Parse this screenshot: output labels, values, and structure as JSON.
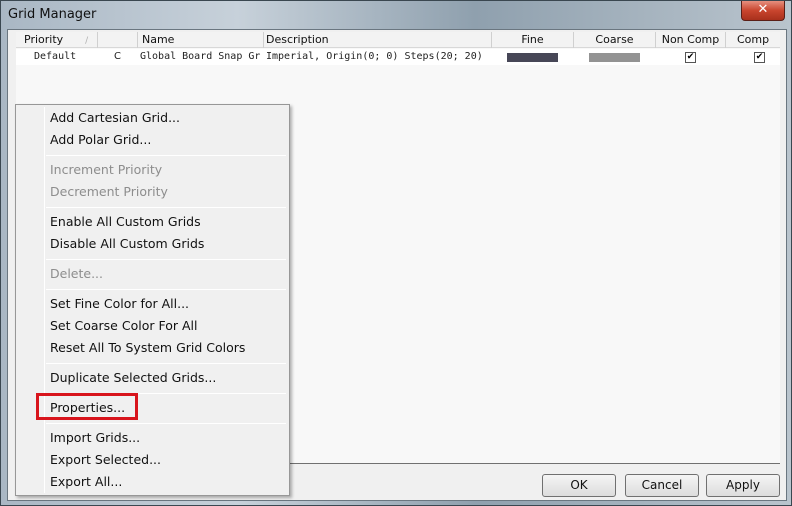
{
  "window": {
    "title": "Grid Manager",
    "close_label": "✕"
  },
  "grid": {
    "columns": [
      {
        "label": "Priority",
        "sort_indicator": "/"
      },
      {
        "label": ""
      },
      {
        "label": "Name"
      },
      {
        "label": "Description"
      },
      {
        "label": "Fine"
      },
      {
        "label": "Coarse"
      },
      {
        "label": "Non Comp"
      },
      {
        "label": "Comp"
      }
    ],
    "rows": [
      {
        "priority": "Default",
        "type": "C",
        "name": "Global Board Snap Gr",
        "description": "Imperial, Origin(0; 0) Steps(20; 20)",
        "fine_color": "#474757",
        "coarse_color": "#939393",
        "non_comp_checked": true,
        "comp_checked": true,
        "check_glyph": "✔"
      }
    ]
  },
  "context_menu": {
    "items": [
      {
        "label": "Add Cartesian Grid...",
        "enabled": true
      },
      {
        "label": "Add Polar Grid...",
        "enabled": true
      },
      {
        "label": "Increment Priority",
        "enabled": false
      },
      {
        "label": "Decrement Priority",
        "enabled": false
      },
      {
        "label": "Enable All Custom Grids",
        "enabled": true
      },
      {
        "label": "Disable All Custom Grids",
        "enabled": true
      },
      {
        "label": "Delete...",
        "enabled": false
      },
      {
        "label": "Set Fine Color for All...",
        "enabled": true
      },
      {
        "label": "Set Coarse Color For All",
        "enabled": true
      },
      {
        "label": "Reset All To System Grid Colors",
        "enabled": true
      },
      {
        "label": "Duplicate Selected Grids...",
        "enabled": true
      },
      {
        "label": "Properties...",
        "enabled": true,
        "highlighted": true
      },
      {
        "label": "Import Grids...",
        "enabled": true
      },
      {
        "label": "Export Selected...",
        "enabled": true
      },
      {
        "label": "Export All...",
        "enabled": true
      }
    ],
    "highlight_color": "#d8141c"
  },
  "buttons": {
    "ok": "OK",
    "cancel": "Cancel",
    "apply": "Apply"
  }
}
